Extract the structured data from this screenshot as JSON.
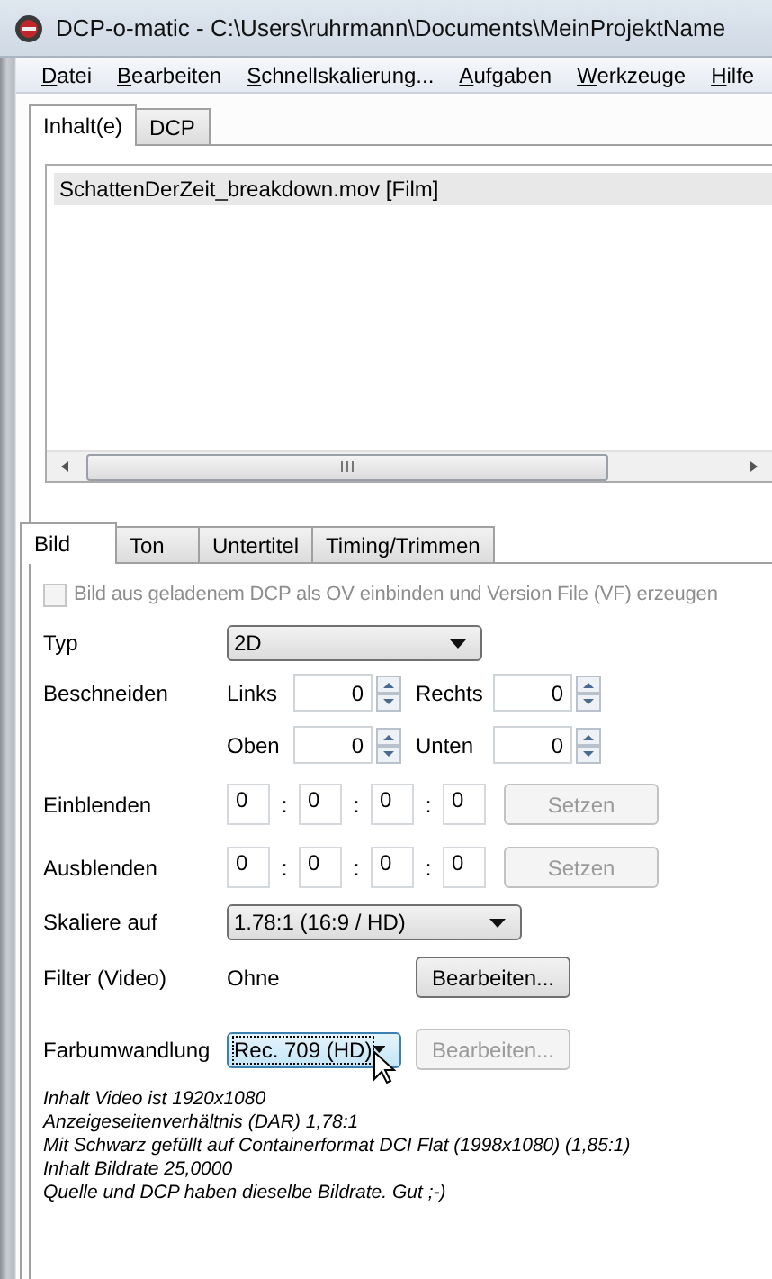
{
  "window": {
    "title": "DCP-o-matic - C:\\Users\\ruhrmann\\Documents\\MeinProjektName"
  },
  "menu": [
    "Datei",
    "Bearbeiten",
    "Schnellskalierung...",
    "Aufgaben",
    "Werkzeuge",
    "Hilfe"
  ],
  "tabs": [
    {
      "label": "Inhalt(e)",
      "selected": true
    },
    {
      "label": "DCP",
      "selected": false
    }
  ],
  "content_list": [
    {
      "label": "SchattenDerZeit_breakdown.mov [Film]",
      "selected": true
    }
  ],
  "sub_tabs": [
    {
      "label": "Bild",
      "selected": true
    },
    {
      "label": "Ton",
      "selected": false
    },
    {
      "label": "Untertitel",
      "selected": false
    },
    {
      "label": "Timing/Trimmen",
      "selected": false
    }
  ],
  "ov_checkbox": {
    "label": "Bild aus geladenem DCP als OV einbinden und Version File (VF) erzeugen",
    "checked": false,
    "disabled": true
  },
  "type": {
    "label": "Typ",
    "value": "2D"
  },
  "crop": {
    "label": "Beschneiden",
    "sides": [
      {
        "label": "Links",
        "value": "0"
      },
      {
        "label": "Rechts",
        "value": "0"
      },
      {
        "label": "Oben",
        "value": "0"
      },
      {
        "label": "Unten",
        "value": "0"
      }
    ]
  },
  "fades": [
    {
      "label": "Einblenden",
      "parts": [
        "0",
        "0",
        "0",
        "0"
      ],
      "separator": ":",
      "button": {
        "label": "Setzen",
        "disabled": true
      }
    },
    {
      "label": "Ausblenden",
      "parts": [
        "0",
        "0",
        "0",
        "0"
      ],
      "separator": ":",
      "button": {
        "label": "Setzen",
        "disabled": true
      }
    }
  ],
  "scale": {
    "label": "Skaliere auf",
    "value": "1.78:1 (16:9 / HD)"
  },
  "filter": {
    "label": "Filter (Video)",
    "value": "Ohne",
    "button": {
      "label": "Bearbeiten...",
      "disabled": false
    }
  },
  "colour": {
    "label": "Farbumwandlung",
    "value": "Rec. 709 (HD)",
    "focused": true,
    "button": {
      "label": "Bearbeiten...",
      "disabled": true
    }
  },
  "info_lines": [
    "Inhalt Video ist 1920x1080",
    "Anzeigeseitenverhältnis (DAR) 1,78:1",
    "Mit Schwarz gefüllt auf Containerformat DCI Flat (1998x1080) (1,85:1)",
    "Inhalt Bildrate 25,0000",
    "Quelle und DCP haben dieselbe Bildrate. Gut ;-)"
  ]
}
